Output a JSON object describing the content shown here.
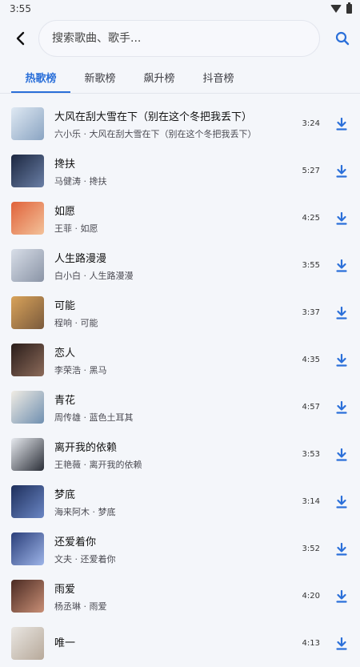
{
  "status_bar": {
    "time": "3:55"
  },
  "search": {
    "placeholder": "搜索歌曲、歌手..."
  },
  "colors": {
    "accent": "#2a6fd9",
    "background": "#f4f6fa"
  },
  "tabs": [
    {
      "label": "热歌榜",
      "active": true
    },
    {
      "label": "新歌榜",
      "active": false
    },
    {
      "label": "飙升榜",
      "active": false
    },
    {
      "label": "抖音榜",
      "active": false
    }
  ],
  "songs": [
    {
      "title": "大风在刮大雪在下（别在这个冬把我丢下）",
      "subtitle": "六小乐 · 大风在刮大雪在下（别在这个冬把我丢下）",
      "duration": "3:24",
      "cover_colors": [
        "#dfe9f3",
        "#8aa4c2"
      ]
    },
    {
      "title": "搀扶",
      "subtitle": "马健涛 · 搀扶",
      "duration": "5:27",
      "cover_colors": [
        "#1c2740",
        "#6a7fa6"
      ]
    },
    {
      "title": "如愿",
      "subtitle": "王菲 · 如愿",
      "duration": "4:25",
      "cover_colors": [
        "#e0623a",
        "#f3c29a"
      ]
    },
    {
      "title": "人生路漫漫",
      "subtitle": "白小白 · 人生路漫漫",
      "duration": "3:55",
      "cover_colors": [
        "#d8dee8",
        "#8a94a6"
      ]
    },
    {
      "title": "可能",
      "subtitle": "程响 · 可能",
      "duration": "3:37",
      "cover_colors": [
        "#d9a35a",
        "#7a5a3c"
      ]
    },
    {
      "title": "恋人",
      "subtitle": "李荣浩 · 黑马",
      "duration": "4:35",
      "cover_colors": [
        "#2a1d1a",
        "#8c6b5a"
      ]
    },
    {
      "title": "青花",
      "subtitle": "周传雄 · 蓝色土耳其",
      "duration": "4:57",
      "cover_colors": [
        "#f0ece4",
        "#6f8fb0"
      ]
    },
    {
      "title": "离开我的依赖",
      "subtitle": "王艳薇 · 离开我的依赖",
      "duration": "3:53",
      "cover_colors": [
        "#e7eaef",
        "#2b2f38"
      ]
    },
    {
      "title": "梦底",
      "subtitle": "海来阿木 · 梦底",
      "duration": "3:14",
      "cover_colors": [
        "#1e2f5c",
        "#6a86c4"
      ]
    },
    {
      "title": "还爱着你",
      "subtitle": "文夫 · 还爱着你",
      "duration": "3:52",
      "cover_colors": [
        "#2b3f7a",
        "#9db4e8"
      ]
    },
    {
      "title": "雨爱",
      "subtitle": "杨丞琳 · 雨爱",
      "duration": "4:20",
      "cover_colors": [
        "#4a2a22",
        "#c98f76"
      ]
    },
    {
      "title": "唯一",
      "subtitle": "",
      "duration": "4:13",
      "cover_colors": [
        "#e9e6e2",
        "#b7a99a"
      ]
    }
  ]
}
